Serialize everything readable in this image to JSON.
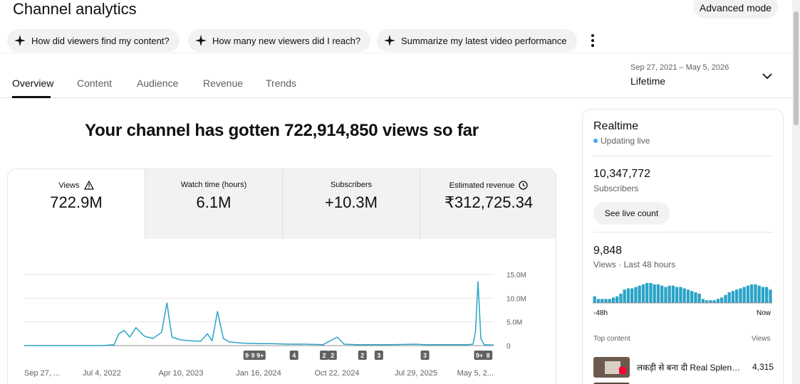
{
  "header": {
    "title": "Channel analytics",
    "advanced_mode": "Advanced mode"
  },
  "chips": [
    {
      "label": "How did viewers find my content?"
    },
    {
      "label": "How many new viewers did I reach?"
    },
    {
      "label": "Summarize my latest video performance"
    }
  ],
  "tabs": [
    {
      "label": "Overview"
    },
    {
      "label": "Content"
    },
    {
      "label": "Audience"
    },
    {
      "label": "Revenue"
    },
    {
      "label": "Trends"
    }
  ],
  "date_range": {
    "range": "Sep 27, 2021 – May 5, 2026",
    "value": "Lifetime"
  },
  "headline": "Your channel has gotten 722,914,850 views so far",
  "metrics": [
    {
      "label": "Views",
      "value": "722.9M",
      "icon": "warning-icon"
    },
    {
      "label": "Watch time (hours)",
      "value": "6.1M"
    },
    {
      "label": "Subscribers",
      "value": "+10.3M"
    },
    {
      "label": "Estimated revenue",
      "value": "₹312,725.34",
      "icon": "clock-icon"
    }
  ],
  "chart_data": {
    "type": "line",
    "title": "",
    "xlabel": "",
    "ylabel": "",
    "ylim": [
      0,
      15000000
    ],
    "yticks": [
      "15.0M",
      "10.0M",
      "5.0M",
      "0"
    ],
    "xticks": [
      "Sep 27, ...",
      "Jul 4, 2022",
      "Apr 10, 2023",
      "Jan 16, 2024",
      "Oct 22, 2024",
      "Jul 29, 2025",
      "May 5, 2..."
    ],
    "color": "#2aa3c7",
    "x": [
      "2021-09-27",
      "2022-01-01",
      "2022-04-01",
      "2022-07-04",
      "2022-08-15",
      "2022-09-01",
      "2022-09-20",
      "2022-10-10",
      "2022-11-01",
      "2022-12-01",
      "2023-01-01",
      "2023-02-01",
      "2023-02-20",
      "2023-03-10",
      "2023-04-10",
      "2023-05-15",
      "2023-06-20",
      "2023-07-15",
      "2023-08-01",
      "2023-08-20",
      "2023-09-10",
      "2023-10-01",
      "2023-11-01",
      "2023-12-01",
      "2024-01-16",
      "2024-03-01",
      "2024-05-01",
      "2024-07-01",
      "2024-09-01",
      "2024-10-22",
      "2024-11-15",
      "2025-01-01",
      "2025-03-01",
      "2025-05-01",
      "2025-07-29",
      "2025-09-01",
      "2025-11-01",
      "2026-01-01",
      "2026-02-01",
      "2026-02-20",
      "2026-03-01",
      "2026-03-10",
      "2026-03-20",
      "2026-04-01",
      "2026-05-05"
    ],
    "y": [
      0,
      0,
      0,
      0,
      200000,
      2500000,
      3200000,
      1800000,
      3800000,
      2000000,
      1500000,
      2800000,
      9000000,
      1800000,
      1200000,
      1000000,
      900000,
      2500000,
      1000000,
      7200000,
      1500000,
      800000,
      600000,
      500000,
      400000,
      400000,
      300000,
      300000,
      200000,
      1800000,
      300000,
      200000,
      200000,
      200000,
      300000,
      200000,
      200000,
      200000,
      200000,
      300000,
      3000000,
      13500000,
      1500000,
      200000,
      100000
    ],
    "markers": [
      {
        "x": "2023-12-10",
        "label": "9+"
      },
      {
        "x": "2024-01-01",
        "label": "9+"
      },
      {
        "x": "2024-01-20",
        "label": "9+"
      },
      {
        "x": "2024-05-20",
        "label": "4"
      },
      {
        "x": "2024-09-05",
        "label": "2"
      },
      {
        "x": "2024-10-05",
        "label": "2"
      },
      {
        "x": "2025-01-20",
        "label": "2"
      },
      {
        "x": "2025-03-20",
        "label": "3"
      },
      {
        "x": "2025-09-01",
        "label": "3"
      },
      {
        "x": "2026-03-15",
        "label": "9+"
      },
      {
        "x": "2026-04-15",
        "label": "8"
      }
    ]
  },
  "realtime": {
    "title": "Realtime",
    "live": "Updating live",
    "subscribers": "10,347,772",
    "subscribers_label": "Subscribers",
    "live_count_button": "See live count",
    "views": "9,848",
    "views_label": "Views · Last 48 hours",
    "axis_left": "-48h",
    "axis_right": "Now",
    "hourly_views": [
      5,
      3,
      3,
      3,
      3,
      4,
      5,
      7,
      10,
      11,
      11,
      12,
      13,
      14,
      15,
      15,
      14,
      14,
      13,
      12,
      13,
      13,
      12,
      12,
      11,
      10,
      9,
      8,
      7,
      3,
      2,
      2,
      2,
      3,
      4,
      6,
      8,
      9,
      10,
      11,
      12,
      13,
      14,
      14,
      13,
      12,
      12,
      10
    ],
    "top_content_label": "Top content",
    "top_views_label": "Views",
    "top_video_title": "लकड़ी से बना दी Real Splendor",
    "top_video_views": "4,315"
  }
}
